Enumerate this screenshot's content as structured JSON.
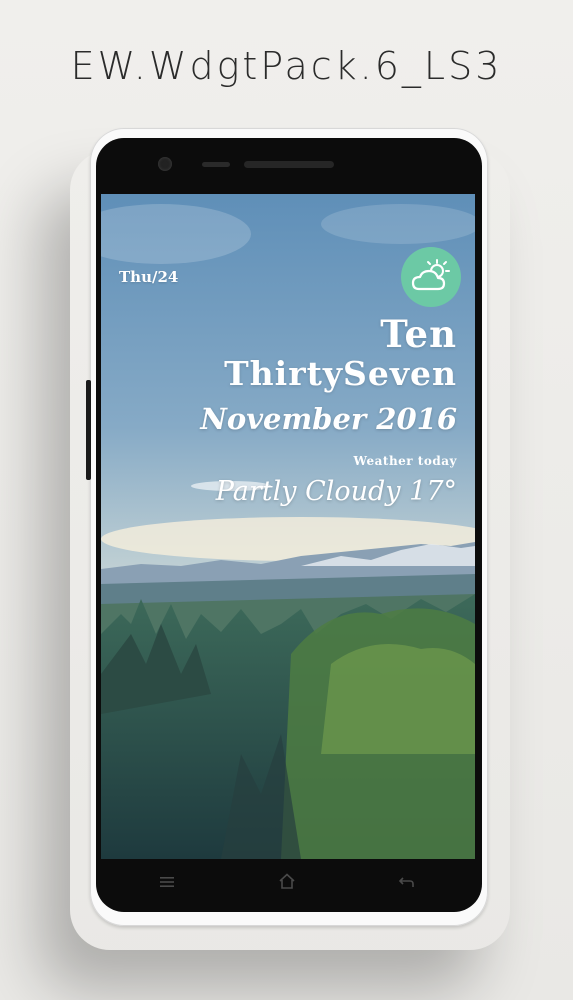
{
  "pack_title": "EW.WdgtPack.6_LS3",
  "widget": {
    "date": "Thu/24",
    "hour": "Ten",
    "minute": "ThirtySeven",
    "month_year": "November 2016",
    "weather_label": "Weather today",
    "condition": "Partly Cloudy 17°",
    "weather_icon": "partly-cloudy-icon",
    "accent_color": "#6cc9a5"
  },
  "navbar": {
    "menu_icon": "menu-icon",
    "home_icon": "home-icon",
    "back_icon": "back-icon"
  }
}
